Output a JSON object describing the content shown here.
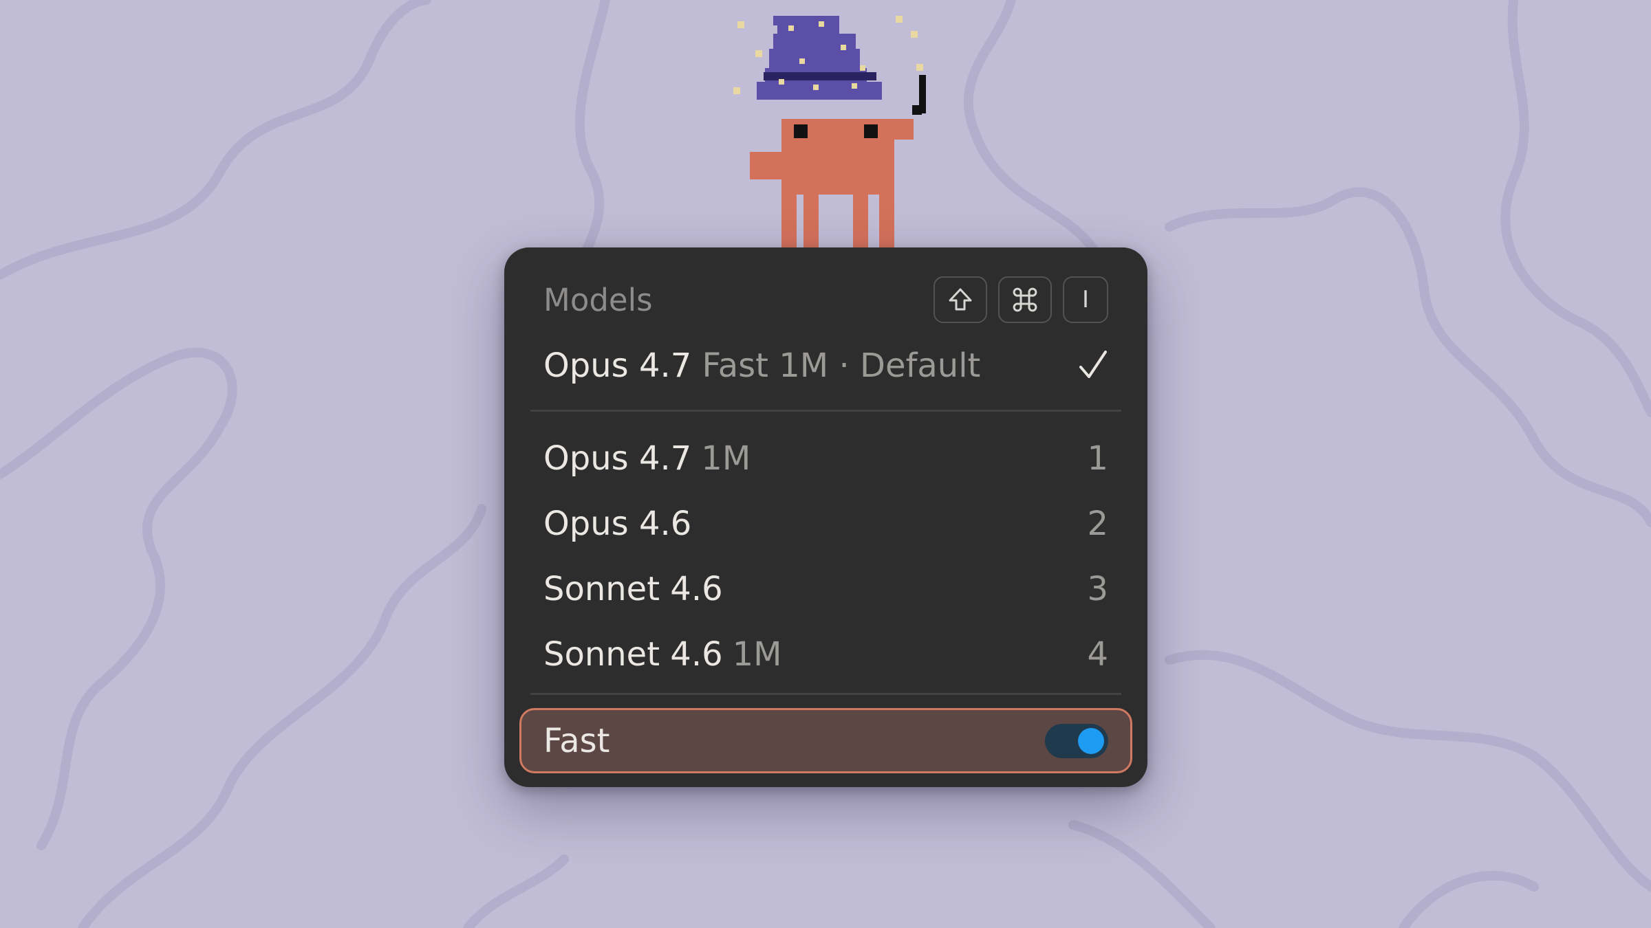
{
  "menu": {
    "title": "Models",
    "shortcut_icons": [
      "shift-icon",
      "command-icon",
      "i-key-icon"
    ],
    "shortcut_key_label": "I",
    "selected": {
      "name": "Opus 4.7",
      "detail": "Fast 1M · Default",
      "icon": "checkmark-icon"
    },
    "items": [
      {
        "name": "Opus 4.7",
        "context": "1M",
        "key": "1"
      },
      {
        "name": "Opus 4.6",
        "context": "",
        "key": "2"
      },
      {
        "name": "Sonnet 4.6",
        "context": "",
        "key": "3"
      },
      {
        "name": "Sonnet 4.6",
        "context": "1M",
        "key": "4"
      }
    ],
    "fast_toggle": {
      "label": "Fast",
      "enabled": true
    }
  },
  "colors": {
    "background": "#c1bdd6",
    "panel": "#2e2d2d",
    "fast_highlight": "#5c4744",
    "fast_border": "#cf7a61",
    "toggle_on": "#1e9bf2",
    "mascot_body": "#d4715a",
    "hat": "#5b4fa8"
  }
}
